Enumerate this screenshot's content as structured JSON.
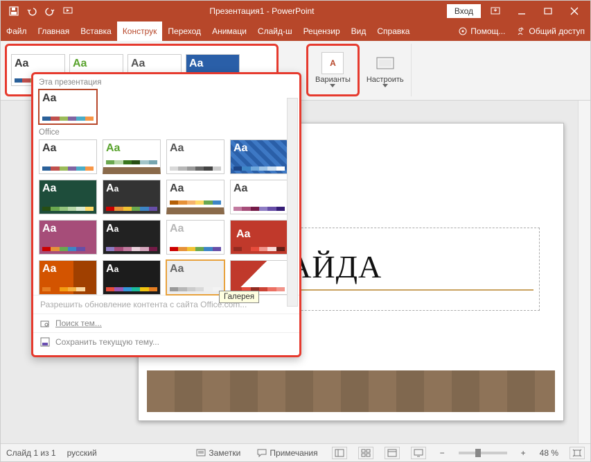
{
  "titlebar": {
    "title": "Презентация1 - PowerPoint",
    "login": "Вход"
  },
  "tabs": {
    "items": [
      "Файл",
      "Главная",
      "Вставка",
      "Конструк",
      "Переход",
      "Анимаци",
      "Слайд-ш",
      "Рецензир",
      "Вид",
      "Справка"
    ],
    "active_index": 3,
    "help_label": "Помощ...",
    "share_label": "Общий доступ"
  },
  "ribbon": {
    "variants_label": "Варианты",
    "customize_label": "Настроить"
  },
  "gallery": {
    "section_current": "Эта презентация",
    "section_office": "Office",
    "hover_tooltip": "Галерея",
    "link_update": "Разрешить обновление контента с сайта Office.com...",
    "link_browse": "Поиск тем...",
    "link_save": "Сохранить текущую тему...",
    "themes_current": [
      {
        "aa": "Aa",
        "fg": "#3b3b3b",
        "bg": "#ffffff",
        "pal": [
          "#2a6099",
          "#c0504d",
          "#9bbb59",
          "#8064a2",
          "#4bacc6",
          "#f79646"
        ]
      }
    ],
    "themes_office": [
      {
        "aa": "Aa",
        "fg": "#3b3b3b",
        "bg": "#ffffff",
        "pal": [
          "#2a6099",
          "#c0504d",
          "#9bbb59",
          "#8064a2",
          "#4bacc6",
          "#f79646"
        ]
      },
      {
        "aa": "Aa",
        "fg": "#5aa32e",
        "bg": "#ffffff",
        "wood": true,
        "pal": [
          "#6aa84f",
          "#b6d7a8",
          "#38761d",
          "#274e13",
          "#a2c4c9",
          "#76a5af"
        ]
      },
      {
        "aa": "Aa",
        "fg": "#555555",
        "bg": "#ffffff",
        "pal": [
          "#d9d9d9",
          "#b7b7b7",
          "#999999",
          "#666666",
          "#434343",
          "#cccccc"
        ]
      },
      {
        "aa": "Aa",
        "fg": "#ffffff",
        "bg": "#2a5fa8",
        "pattern": true,
        "pal": [
          "#1c4587",
          "#3d85c6",
          "#6fa8dc",
          "#9fc5e8",
          "#cfe2f3",
          "#ffffff"
        ]
      },
      {
        "aa": "Aa",
        "fg": "#ffffff",
        "bg": "#1e4d3b",
        "pal": [
          "#274e13",
          "#6aa84f",
          "#93c47d",
          "#b6d7a8",
          "#d9ead3",
          "#ffd966"
        ]
      },
      {
        "aa": "Aa",
        "fg": "#ffffff",
        "bg": "#333333",
        "lowaa": true,
        "pal": [
          "#cc0000",
          "#e69138",
          "#f1c232",
          "#6aa84f",
          "#3d85c6",
          "#674ea7"
        ]
      },
      {
        "aa": "Aa",
        "fg": "#444444",
        "bg": "#ffffff",
        "wood": true,
        "pal": [
          "#b45f06",
          "#e69138",
          "#f6b26b",
          "#ffd966",
          "#6aa84f",
          "#3d85c6"
        ]
      },
      {
        "aa": "Aa",
        "fg": "#444444",
        "bg": "#ffffff",
        "pal": [
          "#c27ba0",
          "#a64d79",
          "#741b47",
          "#8e7cc3",
          "#674ea7",
          "#351c75"
        ]
      },
      {
        "aa": "Aa",
        "fg": "#ffffff",
        "bg": "#a64d79",
        "pal": [
          "#cc0000",
          "#e69138",
          "#6aa84f",
          "#3d85c6",
          "#674ea7",
          "#a64d79"
        ]
      },
      {
        "aa": "Aa",
        "fg": "#ffffff",
        "bg": "#222222",
        "lowaa": true,
        "pal": [
          "#8e7cc3",
          "#a64d79",
          "#c27ba0",
          "#ead1dc",
          "#d5a6bd",
          "#741b47"
        ]
      },
      {
        "aa": "Aa",
        "fg": "#b7b7b7",
        "bg": "#ffffff",
        "pal": [
          "#cc0000",
          "#e69138",
          "#f1c232",
          "#6aa84f",
          "#3d85c6",
          "#674ea7"
        ]
      },
      {
        "aa": "Aa",
        "fg": "#ffffff",
        "bg": "#c0392b",
        "banner": true,
        "pal": [
          "#922b21",
          "#c0392b",
          "#e74c3c",
          "#f1948a",
          "#fadbd8",
          "#641e16"
        ]
      },
      {
        "aa": "Aa",
        "fg": "#ffffff",
        "bg": "#d35400",
        "stripe": true,
        "pal": [
          "#e67e22",
          "#d35400",
          "#f39c12",
          "#f5b041",
          "#fad7a0",
          "#a04000"
        ]
      },
      {
        "aa": "Aa",
        "fg": "#ffffff",
        "bg": "#1c1c1c",
        "lowaa": true,
        "pal": [
          "#e74c3c",
          "#9b59b6",
          "#3498db",
          "#1abc9c",
          "#f1c40f",
          "#e67e22"
        ]
      },
      {
        "aa": "Aa",
        "fg": "#666666",
        "bg": "#eeeeee",
        "pal": [
          "#999999",
          "#b7b7b7",
          "#cccccc",
          "#d9d9d9",
          "#efefef",
          "#f3f3f3"
        ]
      },
      {
        "aa": "Aa",
        "fg": "#c0392b",
        "bg": "#ffffff",
        "angled": true,
        "pal": [
          "#c0392b",
          "#e74c3c",
          "#922b21",
          "#cb4335",
          "#ec7063",
          "#f1948a"
        ]
      }
    ]
  },
  "slide": {
    "title_placeholder": "ВОК СЛАЙДА"
  },
  "statusbar": {
    "slide_counter": "Слайд 1 из 1",
    "language": "русский",
    "notes": "Заметки",
    "comments": "Примечания",
    "zoom": "48 %"
  }
}
